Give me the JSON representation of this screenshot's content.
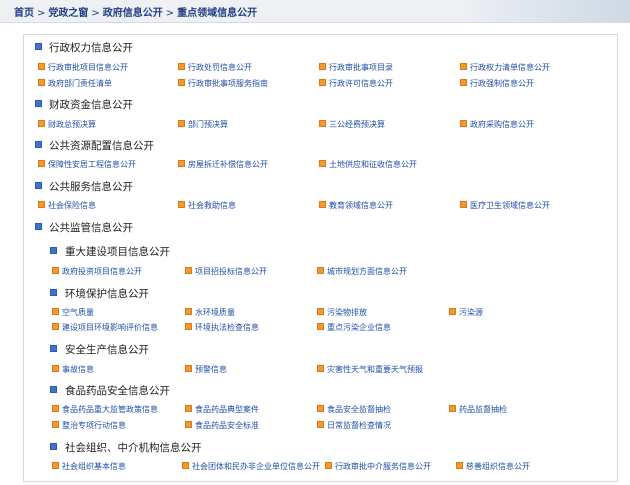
{
  "breadcrumb": [
    "首页",
    "党政之窗",
    "政府信息公开",
    "重点领域信息公开"
  ],
  "breadcrumb_sep": ">",
  "colors": {
    "accent": "#1f4fa8",
    "title_marker": "#3e73c8",
    "link_marker": "#f29a32"
  },
  "icons": {
    "section_marker": "square-bullet-icon",
    "link_marker": "orange-square-icon"
  },
  "sections": [
    {
      "title": "行政权力信息公开",
      "links": [
        "行政审批项目信息公开",
        "行政处罚信息公开",
        "行政审批事项目录",
        "行政权力清单信息公开",
        "政府部门责任清单",
        "行政审批事项服务指南",
        "行政许可信息公开",
        "行政强制信息公开"
      ]
    },
    {
      "title": "财政资金信息公开",
      "links": [
        "财政总预决算",
        "部门预决算",
        "三公经费预决算",
        "政府采购信息公开"
      ]
    },
    {
      "title": "公共资源配置信息公开",
      "links": [
        "保障性安居工程信息公开",
        "房屋拆迁补偿信息公开",
        "土地供应和征收信息公开"
      ]
    },
    {
      "title": "公共服务信息公开",
      "links": [
        "社会保险信息",
        "社会救助信息",
        "教育领域信息公开",
        "医疗卫生领域信息公开"
      ]
    },
    {
      "title": "公共监管信息公开",
      "subsections": [
        {
          "title": "重大建设项目信息公开",
          "links": [
            "政府投资项目信息公开",
            "项目招投标信息公开",
            "城市规划方面信息公开"
          ]
        },
        {
          "title": "环境保护信息公开",
          "links": [
            "空气质量",
            "水环境质量",
            "污染物排放",
            "污染源",
            "建设项目环境影响评价信息",
            "环境执法检查信息",
            "重点污染企业信息"
          ]
        },
        {
          "title": "安全生产信息公开",
          "links": [
            "事故信息",
            "预警信息",
            "灾害性天气和重要天气预报"
          ]
        },
        {
          "title": "食品药品安全信息公开",
          "links": [
            "食品药品重大监管政策信息",
            "食品药品典型案件",
            "食品安全监督抽检",
            "药品监督抽检",
            "整治专项行动信息",
            "食品药品安全标准",
            "日常监督检查情况"
          ]
        },
        {
          "title": "社会组织、中介机构信息公开",
          "links": [
            "社会组织基本信息",
            "社会团体和民办非企业单位信息公开",
            "行政审批中介服务信息公开",
            "慈善组织信息公开"
          ]
        }
      ]
    }
  ]
}
